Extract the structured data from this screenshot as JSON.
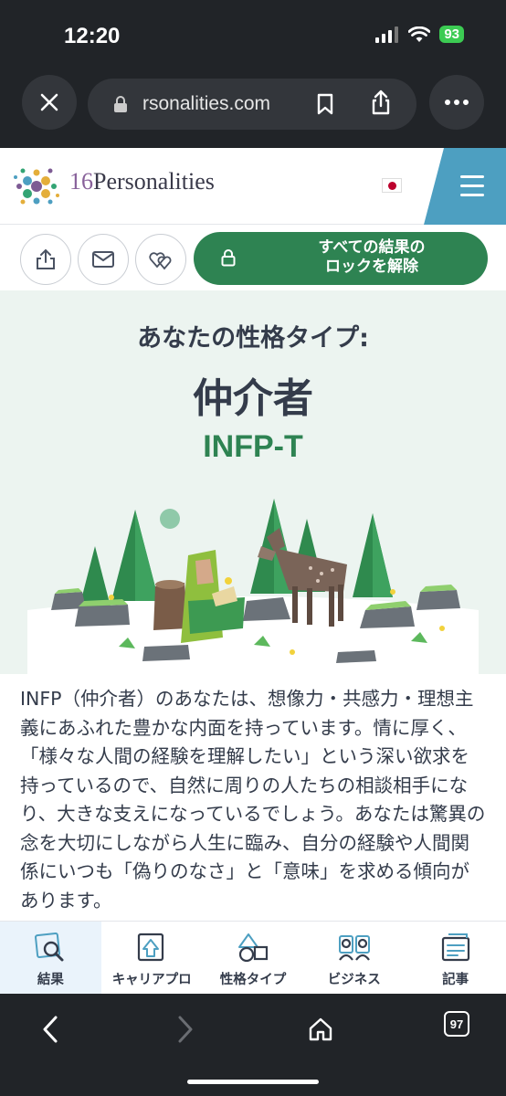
{
  "status_bar": {
    "time": "12:20",
    "battery": "93"
  },
  "browser": {
    "url": "rsonalities.com",
    "tab_count": "97"
  },
  "site": {
    "logo_number": "16",
    "logo_name": "Personalities",
    "unlock_button": {
      "line1": "すべての結果の",
      "line2": "ロックを解除"
    },
    "hero": {
      "subtitle": "あなたの性格タイプ:",
      "title": "仲介者",
      "code": "INFP-T"
    },
    "body_text": "INFP（仲介者）のあなたは、想像力・共感力・理想主義にあふれた豊かな内面を持っています。情に厚く、「様々な人間の経験を理解したい」という深い欲求を持っているので、自然に周りの人たちの相談相手になり、大きな支えになっているでしょう。あなたは驚異の念を大切にしながら人生に臨み、自分の経験や人間関係にいつも「偽りのなさ」と「意味」を求める傾向があります。"
  },
  "tabs": [
    {
      "label": "結果",
      "icon": "results-icon",
      "active": true
    },
    {
      "label": "キャリアプロ",
      "icon": "career-icon"
    },
    {
      "label": "性格タイプ",
      "icon": "types-icon"
    },
    {
      "label": "ビジネス",
      "icon": "business-icon"
    },
    {
      "label": "記事",
      "icon": "articles-icon"
    }
  ],
  "colors": {
    "brand_green": "#2e8352",
    "hero_bg": "#ecf4f0",
    "menu_blue": "#4d9fc1",
    "text_dark": "#343c4b"
  }
}
